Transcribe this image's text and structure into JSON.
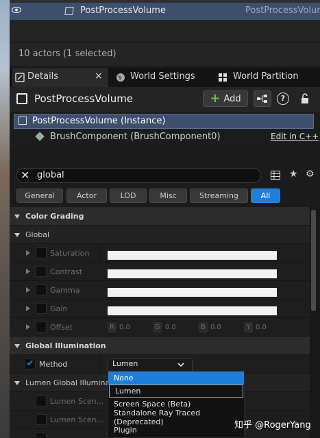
{
  "outliner": {
    "actor_name": "PostProcessVolume",
    "actor_type": "PostProcessVolum",
    "count_text": "10 actors (1 selected)"
  },
  "tabs": [
    {
      "label": "Details",
      "icon": "details-icon"
    },
    {
      "label": "World Settings",
      "icon": "globe-icon"
    },
    {
      "label": "World Partition",
      "icon": "grid-icon"
    }
  ],
  "tab_close": "×",
  "header": {
    "title": "PostProcessVolume",
    "add_label": "Add"
  },
  "components": {
    "instance": "PostProcessVolume (Instance)",
    "child": "BrushComponent (BrushComponent0)",
    "edit_link": "Edit in C++"
  },
  "search": {
    "value": "global"
  },
  "filters": [
    "General",
    "Actor",
    "LOD",
    "Misc",
    "Streaming",
    "All"
  ],
  "sections": {
    "color_grading": "Color Grading",
    "global": "Global",
    "global_illumination": "Global Illumination",
    "lumen_gi": "Lumen Global Illumina"
  },
  "properties": {
    "saturation": "Saturation",
    "contrast": "Contrast",
    "gamma": "Gamma",
    "gain": "Gain",
    "offset": "Offset",
    "method": "Method",
    "lumen_scene_1": "Lumen Scen...",
    "lumen_scene_2": "Lumen Scen..."
  },
  "offset_values": {
    "r_label": "R",
    "r_val": "0.0",
    "g_label": "G",
    "g_val": "0.0",
    "b_label": "B",
    "b_val": "0.0",
    "y_label": "Y",
    "y_val": "0.0"
  },
  "method_dropdown": {
    "value": "Lumen",
    "options": [
      "None",
      "Lumen",
      "Screen Space (Beta)",
      "Standalone Ray Traced (Deprecated)",
      "Plugin"
    ],
    "highlighted": "None",
    "selected": "Lumen"
  },
  "watermark": "知乎 @RogerYang",
  "colors": {
    "accent": "#1f7fd8",
    "selection": "#3e4f6d",
    "add_plus": "#6fbf4b"
  }
}
